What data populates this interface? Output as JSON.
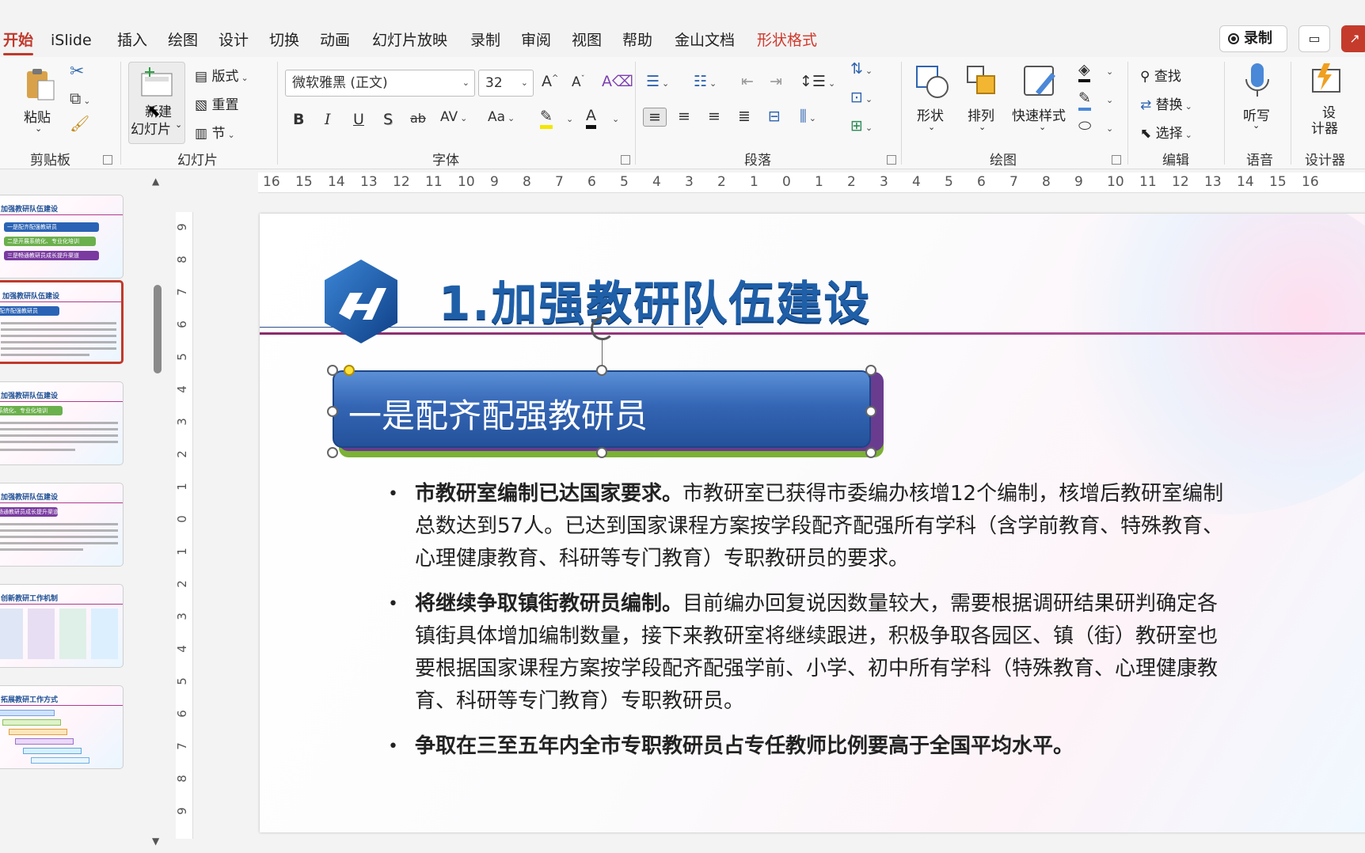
{
  "menu": {
    "tabs": [
      "开始",
      "iSlide",
      "插入",
      "绘图",
      "设计",
      "切换",
      "动画",
      "幻灯片放映",
      "录制",
      "审阅",
      "视图",
      "帮助",
      "金山文档",
      "形状格式"
    ],
    "record_label": "录制"
  },
  "ribbon": {
    "clipboard": {
      "paste": "粘贴",
      "label": "剪贴板"
    },
    "slides": {
      "new_slide": "新建幻灯片",
      "new_slide_line1": "新建",
      "new_slide_line2": "幻灯片",
      "layout": "版式",
      "reset": "重置",
      "section": "节",
      "label": "幻灯片"
    },
    "font": {
      "name": "微软雅黑 (正文)",
      "size": "32",
      "label": "字体",
      "grow": "A^",
      "shrink": "Aˇ",
      "bold": "B",
      "italic": "I",
      "underline": "U",
      "shadow": "S",
      "strike": "ab",
      "spacing": "AV",
      "case": "Aa",
      "color_letter": "A"
    },
    "paragraph": {
      "label": "段落"
    },
    "drawing": {
      "shape": "形状",
      "arrange": "排列",
      "quick_style": "快速样式",
      "label": "绘图"
    },
    "editing": {
      "find": "查找",
      "replace": "替换",
      "select": "选择",
      "label": "编辑"
    },
    "voice": {
      "dictate": "听写",
      "label": "语音"
    },
    "designer": {
      "button_line1": "设",
      "button_line2": "计器",
      "label": "设计器"
    }
  },
  "ruler": {
    "h_ticks": [
      "16",
      "15",
      "14",
      "13",
      "12",
      "11",
      "10",
      "9",
      "8",
      "7",
      "6",
      "5",
      "4",
      "3",
      "2",
      "1",
      "0",
      "1",
      "2",
      "3",
      "4",
      "5",
      "6",
      "7",
      "8",
      "9",
      "10",
      "11",
      "12",
      "13",
      "14",
      "15",
      "16"
    ],
    "v_ticks": [
      "9",
      "8",
      "7",
      "6",
      "5",
      "4",
      "3",
      "2",
      "1",
      "0",
      "1",
      "2",
      "3",
      "4",
      "5",
      "6",
      "7",
      "8",
      "9"
    ]
  },
  "thumbnails": [
    {
      "title": "加强教研队伍建设",
      "pills": [
        "一是配齐配强教研员",
        "二是开展系统化、专业化培训",
        "三是畅通教研员成长提升渠道"
      ]
    },
    {
      "title": "加强教研队伍建设",
      "pills": [
        "配齐配强教研员"
      ]
    },
    {
      "title": "加强教研队伍建设",
      "pills": [
        "系统化、专业化培训"
      ]
    },
    {
      "title": "加强教研队伍建设",
      "pills": [
        "畅通教研员成长提升渠道"
      ]
    },
    {
      "title": "创新教研工作机制",
      "pills": []
    },
    {
      "title": "拓展教研工作方式",
      "pills": []
    }
  ],
  "slide": {
    "title": "1.加强教研队伍建设",
    "shape_text": "一是配齐配强教研员",
    "bullets": [
      {
        "bold": "市教研室编制已达国家要求。",
        "text": "市教研室已获得市委编办核增12个编制，核增后教研室编制总数达到57人。已达到国家课程方案按学段配齐配强所有学科（含学前教育、特殊教育、心理健康教育、科研等专门教育）专职教研员的要求。"
      },
      {
        "bold": "将继续争取镇街教研员编制。",
        "text": "目前编办回复说因数量较大，需要根据调研结果研判确定各镇街具体增加编制数量，接下来教研室将继续跟进，积极争取各园区、镇（街）教研室也要根据国家课程方案按学段配齐配强学前、小学、初中所有学科（特殊教育、心理健康教育、科研等专门教育）专职教研员。"
      },
      {
        "bold": "争取在三至五年内全市专职教研员占专任教师比例要高于全国平均水平。",
        "text": ""
      }
    ]
  },
  "colors": {
    "accent": "#c0392b",
    "title_blue": "#1f5fa8",
    "shape_blue": "#3466b5",
    "divider_purple": "#9b3d86"
  }
}
